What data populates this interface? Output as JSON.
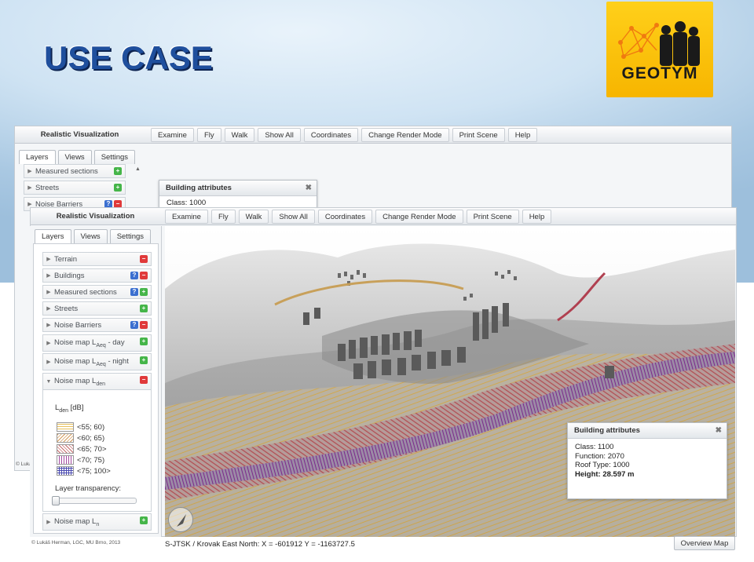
{
  "slide": {
    "title": "USE CASE",
    "logo_text": "GEOTÝM"
  },
  "back_window": {
    "app_name": "Realistic Visualization",
    "toolbar": [
      "Examine",
      "Fly",
      "Walk",
      "Show All",
      "Coordinates",
      "Change Render Mode",
      "Print Scene",
      "Help"
    ],
    "tabs": [
      "Layers",
      "Views",
      "Settings"
    ],
    "layers": [
      {
        "label": "Measured sections"
      },
      {
        "label": "Streets"
      },
      {
        "label": "Noise Barriers"
      }
    ],
    "attributes_title": "Building attributes",
    "attributes_first": "Class: 1000",
    "copyright": "© Luká"
  },
  "front_window": {
    "app_name": "Realistic Visualization",
    "toolbar": [
      "Examine",
      "Fly",
      "Walk",
      "Show All",
      "Coordinates",
      "Change Render Mode",
      "Print Scene",
      "Help"
    ],
    "tabs": [
      "Layers",
      "Views",
      "Settings"
    ],
    "layers": [
      {
        "label": "Terrain"
      },
      {
        "label": "Buildings"
      },
      {
        "label": "Measured sections"
      },
      {
        "label": "Streets"
      },
      {
        "label": "Noise Barriers"
      },
      {
        "label": "Noise map L",
        "sub": "Aeq",
        "suffix": " - day"
      },
      {
        "label": "Noise map L",
        "sub": "Aeq",
        "suffix": " - night"
      },
      {
        "label": "Noise map L",
        "sub": "den",
        "suffix": ""
      }
    ],
    "legend": {
      "title": "L",
      "title_sub": "den",
      "title_unit": " [dB]",
      "items": [
        {
          "label": "<55; 60)",
          "color": "#e8c05a"
        },
        {
          "label": "<60; 65)",
          "color": "#d49a5a"
        },
        {
          "label": "<65; 70>",
          "color": "#c66a6a"
        },
        {
          "label": "<70; 75)",
          "color": "#a44aa0"
        },
        {
          "label": "<75; 100>",
          "color": "#4a4ab0"
        }
      ],
      "transparency_label": "Layer transparency:",
      "transparency_value": 0
    },
    "last_layer": {
      "label": "Noise map L",
      "sub": "n"
    },
    "attributes": {
      "title": "Building attributes",
      "lines": [
        "Class: 1100",
        "Function: 2070",
        "Roof Type: 1000",
        "Height: 28.597 m"
      ]
    },
    "status": "S-JTSK / Krovak East North: X = -601912 Y = -1163727.5",
    "copyright": "© Lukáš Herman, LGC, MU Brno, 2013",
    "overview_button": "Overview Map"
  },
  "colors": {
    "title_blue": "#1f4f9d",
    "logo_yellow": "#ffd01a",
    "badge_plus": "#45b549",
    "badge_minus": "#e0393a",
    "badge_info": "#3b6fd0"
  }
}
